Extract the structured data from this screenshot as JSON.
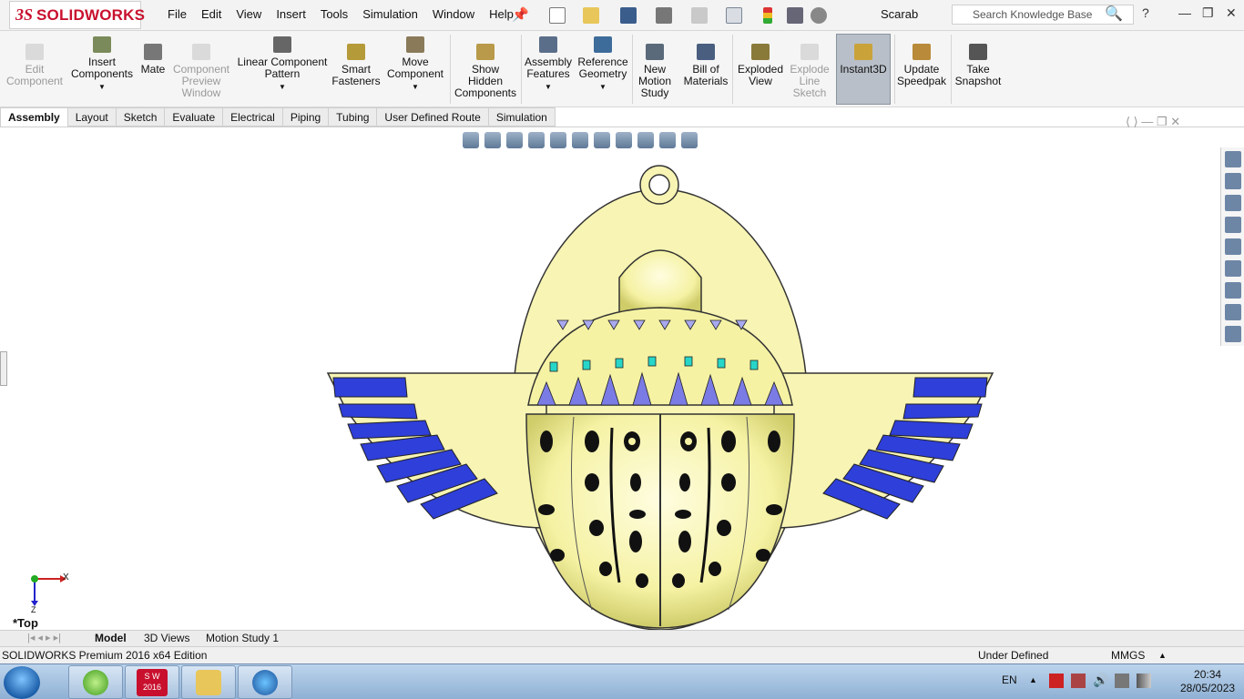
{
  "app": {
    "brand_ds": "3S",
    "brand_name": "SOLIDWORKS",
    "document_title": "Scarab",
    "search_placeholder": "Search Knowledge Base"
  },
  "menu": [
    "File",
    "Edit",
    "View",
    "Insert",
    "Tools",
    "Simulation",
    "Window",
    "Help"
  ],
  "ribbon": {
    "edit_component": "Edit Component",
    "insert_components": "Insert Components",
    "mate": "Mate",
    "component_preview_window": "Component Preview Window",
    "linear_component_pattern": "Linear Component Pattern",
    "smart_fasteners": "Smart Fasteners",
    "move_component": "Move Component",
    "show_hidden_components": "Show Hidden Components",
    "assembly_features": "Assembly Features",
    "reference_geometry": "Reference Geometry",
    "new_motion_study": "New Motion Study",
    "bill_of_materials": "Bill of Materials",
    "exploded_view": "Exploded View",
    "explode_line_sketch": "Explode Line Sketch",
    "instant3d": "Instant3D",
    "update_speedpak": "Update Speedpak",
    "take_snapshot": "Take Snapshot"
  },
  "tabs": [
    "Assembly",
    "Layout",
    "Sketch",
    "Evaluate",
    "Electrical",
    "Piping",
    "Tubing",
    "User Defined Route",
    "Simulation"
  ],
  "viewport": {
    "view_name": "*Top",
    "triad_x": "X",
    "triad_z": "Z"
  },
  "bottom_tabs": [
    "Model",
    "3D Views",
    "Motion Study 1"
  ],
  "status": {
    "edition": "SOLIDWORKS Premium 2016 x64 Edition",
    "state": "Under Defined",
    "units": "MMGS"
  },
  "taskbar": {
    "language": "EN",
    "time": "20:34",
    "date": "28/05/2023",
    "sw_badge": "S W",
    "sw_year": "2016"
  },
  "colors": {
    "brand_red": "#c8102e",
    "model_gold": "#f5f2a4",
    "model_shade": "#d9d77a",
    "wing_blue": "#2f3fd9",
    "inlay_cyan": "#27d6c8",
    "inlay_lavender": "#a9a9f0"
  }
}
